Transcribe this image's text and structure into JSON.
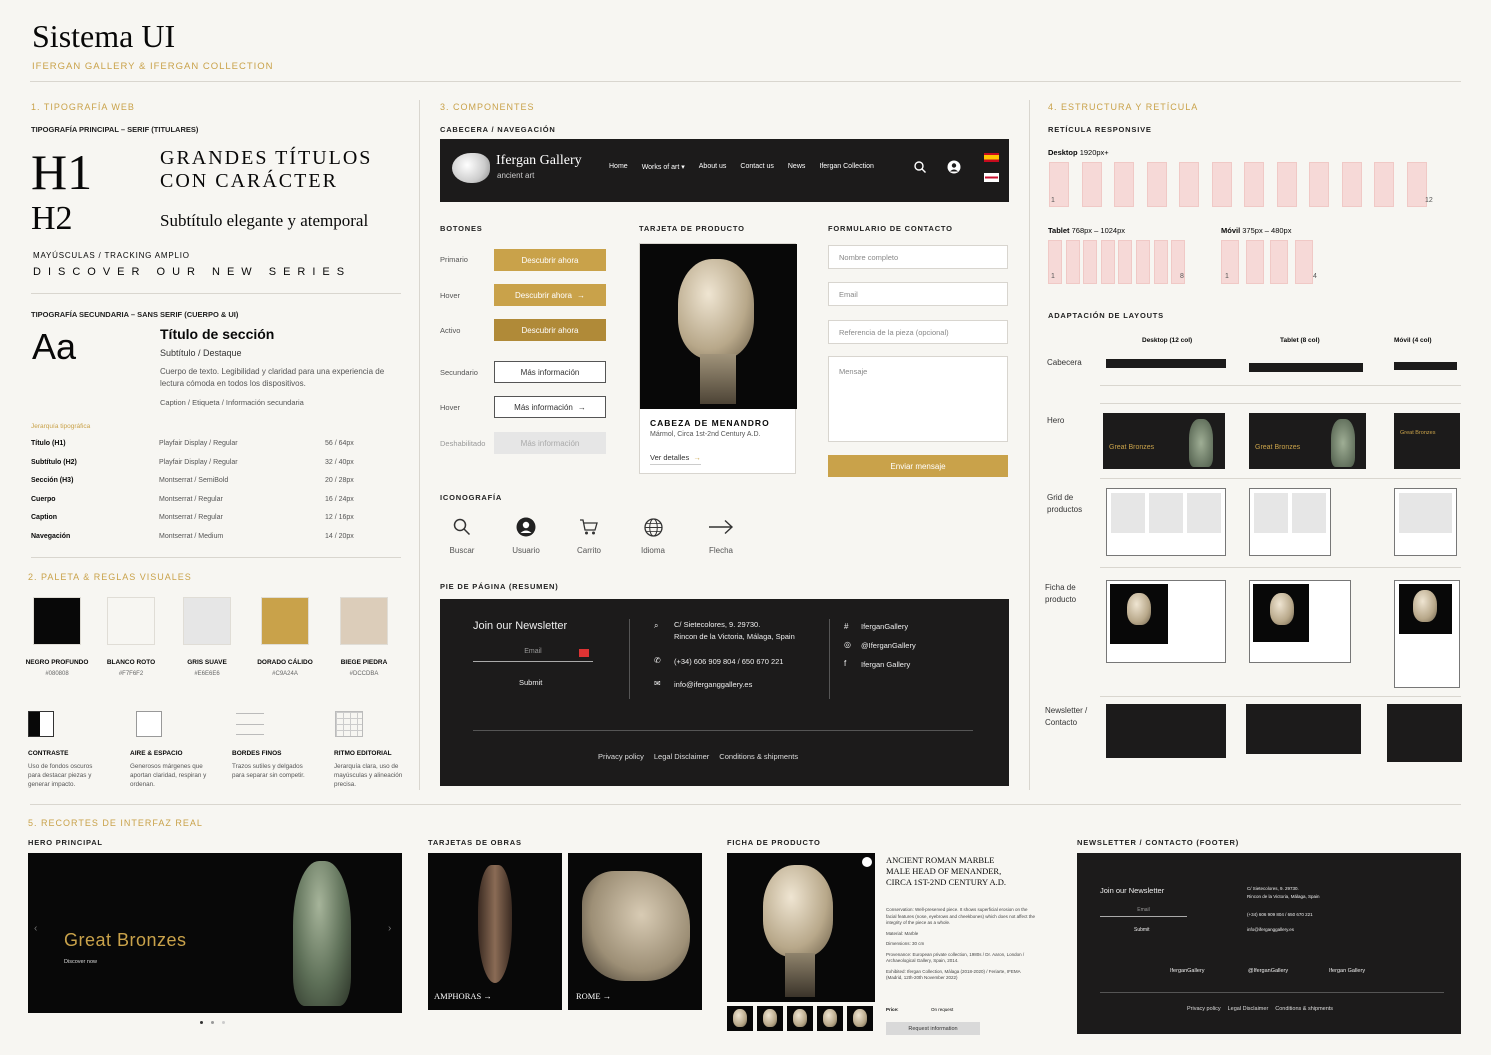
{
  "header": {
    "title": "Sistema UI",
    "subtitle": "IFERGAN GALLERY & IFERGAN COLLECTION"
  },
  "typo": {
    "section": "1. TIPOGRAFÍA WEB",
    "primary": "TIPOGRAFÍA PRINCIPAL – SERIF (TITULARES)",
    "h1": "H1",
    "h1_text_1": "Grandes títulos",
    "h1_text_2": "con carácter",
    "h2": "H2",
    "h2_text": "Subtítulo elegante y atemporal",
    "caps_label": "MAYÚSCULAS / TRACKING AMPLIO",
    "caps_text": "DISCOVER OUR NEW SERIES",
    "secondary": "TIPOGRAFÍA SECUNDARIA – SANS SERIF (CUERPO & UI)",
    "aa": "Aa",
    "section_title": "Título de sección",
    "subtitle": "Subtítulo / Destaque",
    "body": "Cuerpo de texto. Legibilidad y claridad para una experiencia de lectura cómoda en todos los dispositivos.",
    "caption": "Caption / Etiqueta / Información secundaria",
    "hierarchy": "Jerarquía tipográfica",
    "rows": [
      [
        "Título (H1)",
        "Playfair Display / Regular",
        "56 / 64px"
      ],
      [
        "Subtítulo (H2)",
        "Playfair Display / Regular",
        "32 / 40px"
      ],
      [
        "Sección (H3)",
        "Montserrat / SemiBold",
        "20 / 28px"
      ],
      [
        "Cuerpo",
        "Montserrat / Regular",
        "16 / 24px"
      ],
      [
        "Caption",
        "Montserrat / Regular",
        "12 / 16px"
      ],
      [
        "Navegación",
        "Montserrat / Medium",
        "14 / 20px"
      ]
    ]
  },
  "palette": {
    "section": "2. PALETA & REGLAS VISUALES",
    "swatches": [
      {
        "name": "NEGRO PROFUNDO",
        "hex": "#080808",
        "color": "#080808"
      },
      {
        "name": "BLANCO ROTO",
        "hex": "#F7F6F2",
        "color": "#F7F6F2"
      },
      {
        "name": "GRIS SUAVE",
        "hex": "#E6E6E6",
        "color": "#E6E6E6"
      },
      {
        "name": "DORADO CÁLIDO",
        "hex": "#C9A24A",
        "color": "#C9A24A"
      },
      {
        "name": "BIEGE PIEDRA",
        "hex": "#DCCDBA",
        "color": "#DCCDBA"
      }
    ],
    "rules": [
      {
        "t": "CONTRASTE",
        "d": "Uso de fondos oscuros para destacar piezas y generar impacto."
      },
      {
        "t": "AIRE & ESPACIO",
        "d": "Generosos márgenes que aportan claridad, respiran y ordenan."
      },
      {
        "t": "BORDES FINOS",
        "d": "Trazos sutiles y delgados para separar sin competir."
      },
      {
        "t": "RITMO EDITORIAL",
        "d": "Jerarquía clara, uso de mayúsculas y alineación precisa."
      }
    ]
  },
  "components": {
    "section": "3. COMPONENTES",
    "nav_label": "CABECERA / NAVEGACIÓN",
    "brand": "Ifergan Gallery",
    "brand_sub": "ancient art",
    "nav": [
      "Home",
      "Works of art",
      "About us",
      "Contact us",
      "News",
      "Ifergan Collection"
    ],
    "buttons_label": "BOTONES",
    "btn_rows": [
      "Primario",
      "Hover",
      "Activo",
      "Secundario",
      "Hover",
      "Deshabilitado"
    ],
    "btn_primary": "Descubrir ahora",
    "btn_secondary": "Más información",
    "card_label": "TARJETA DE PRODUCTO",
    "card_title": "CABEZA DE MENANDRO",
    "card_sub": "Mármol, Circa 1st-2nd Century A.D.",
    "card_link": "Ver detalles",
    "form_label": "FORMULARIO DE CONTACTO",
    "form_name": "Nombre completo",
    "form_email": "Email",
    "form_ref": "Referencia de la pieza (opcional)",
    "form_msg": "Mensaje",
    "form_submit": "Enviar mensaje",
    "icons_label": "ICONOGRAFÍA",
    "icons": [
      "Buscar",
      "Usuario",
      "Carrito",
      "Idioma",
      "Flecha"
    ],
    "footer_label": "PIE DE PÁGINA (RESUMEN)",
    "newsletter": "Join our Newsletter",
    "email": "Email",
    "submit": "Submit",
    "addr1": "C/ Sietecolores, 9. 29730.",
    "addr2": "Rincon de la Victoria, Málaga, Spain",
    "phone": "(+34) 606 909 804 / 650 670 221",
    "mail": "info@iferganggallery.es",
    "social": [
      "IferganGallery",
      "@IferganGallery",
      "Ifergan Gallery"
    ],
    "legal": [
      "Privacy policy",
      "Legal Disclaimer",
      "Conditions & shipments"
    ]
  },
  "grid": {
    "section": "4. ESTRUCTURA Y RETÍCULA",
    "responsive": "RETÍCULA RESPONSIVE",
    "desktop": "Desktop",
    "desktop_px": "1920px+",
    "tablet": "Tablet",
    "tablet_px": "768px – 1024px",
    "mobile": "Móvil",
    "mobile_px": "375px – 480px",
    "n1": "1",
    "n12": "12",
    "n8": "8",
    "n4": "4",
    "adapt": "ADAPTACIÓN DE LAYOUTS",
    "cols": [
      "Desktop (12 col)",
      "Tablet (8 col)",
      "Móvil (4 col)"
    ],
    "rows": [
      "Cabecera",
      "Hero",
      "Grid de productos",
      "Ficha de producto",
      "Newsletter / Contacto"
    ],
    "hero_text": "Great Bronzes"
  },
  "real": {
    "section": "5. RECORTES DE INTERFAZ REAL",
    "hero_label": "HERO PRINCIPAL",
    "hero_title": "Great Bronzes",
    "hero_cta": "Discover now",
    "cards_label": "TARJETAS DE OBRAS",
    "card1": "AMPHORAS",
    "card2": "ROME",
    "ficha_label": "FICHA DE PRODUCTO",
    "ficha_title": "ANCIENT ROMAN MARBLE MALE HEAD OF MENANDER, CIRCA 1ST-2ND CENTURY A.D.",
    "ficha_lines": [
      "Conservation: Well-preserved piece. It shows superficial erosion on the facial features (nose, eyebrows and cheekbones) which does not affect the integrity of the piece as a whole.",
      "Material: Marble",
      "Dimensions: 30 cm",
      "Provenance: European private collection, 1980s / Dr. Aaron, London / Archaeological Gallery, Spain, 2014.",
      "Exhibited: Ifergan Collection, Málaga (2018-2020) / Feriarte, IFEMA (Madrid, 12th-20th November 2022)"
    ],
    "price_label": "Price:",
    "price": "On request",
    "request": "Request information",
    "news_label": "NEWSLETTER / CONTACTO (FOOTER)"
  }
}
